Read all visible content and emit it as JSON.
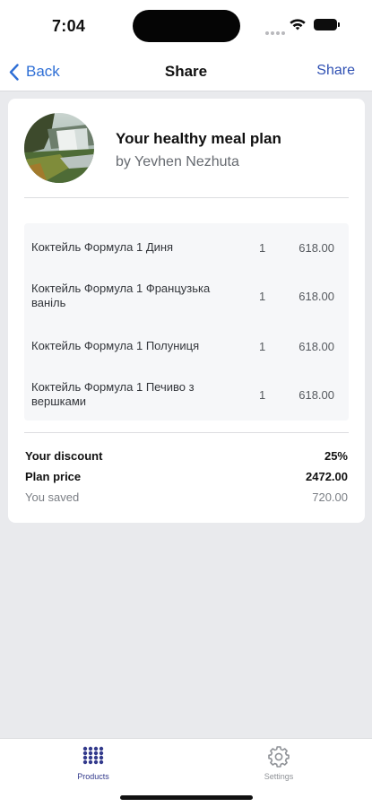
{
  "status_bar": {
    "time": "7:04"
  },
  "nav": {
    "back_label": "Back",
    "title": "Share",
    "share_label": "Share"
  },
  "plan": {
    "title": "Your healthy meal plan",
    "author": "by Yevhen Nezhuta"
  },
  "items": [
    {
      "name": "Коктейль Формула 1 Диня",
      "qty": "1",
      "price": "618.00"
    },
    {
      "name": "Коктейль Формула 1 Французька ваніль",
      "qty": "1",
      "price": "618.00"
    },
    {
      "name": "Коктейль Формула 1 Полуниця",
      "qty": "1",
      "price": "618.00"
    },
    {
      "name": "Коктейль Формула 1 Печиво з вершками",
      "qty": "1",
      "price": "618.00"
    }
  ],
  "summary": {
    "discount_label": "Your discount",
    "discount_value": "25%",
    "price_label": "Plan price",
    "price_value": "2472.00",
    "saved_label": "You saved",
    "saved_value": "720.00"
  },
  "tabs": [
    {
      "label": "Products",
      "icon": "grid-icon",
      "active": true
    },
    {
      "label": "Settings",
      "icon": "gear-icon",
      "active": false
    }
  ],
  "colors": {
    "accent": "#2f6fd6",
    "active_tab": "#333a8c",
    "background": "#e9eaed"
  }
}
